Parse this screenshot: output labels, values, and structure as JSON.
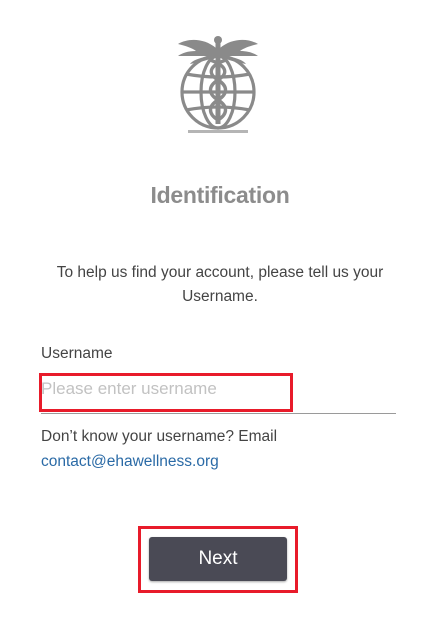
{
  "logo": {
    "icon": "caduceus-globe-icon",
    "color": "#8a8a8a"
  },
  "title": "Identification",
  "instructions": "To help us find your account, please tell us your Username.",
  "username_field": {
    "label": "Username",
    "placeholder": "Please enter username",
    "value": ""
  },
  "help": {
    "text": "Don’t know your username? Email",
    "email_link": "contact@ehawellness.org"
  },
  "next_button": {
    "label": "Next"
  },
  "colors": {
    "highlight": "#e81b2a",
    "button_bg": "#4a4a55",
    "link": "#2a6aa6",
    "title": "#8c8c8c"
  }
}
